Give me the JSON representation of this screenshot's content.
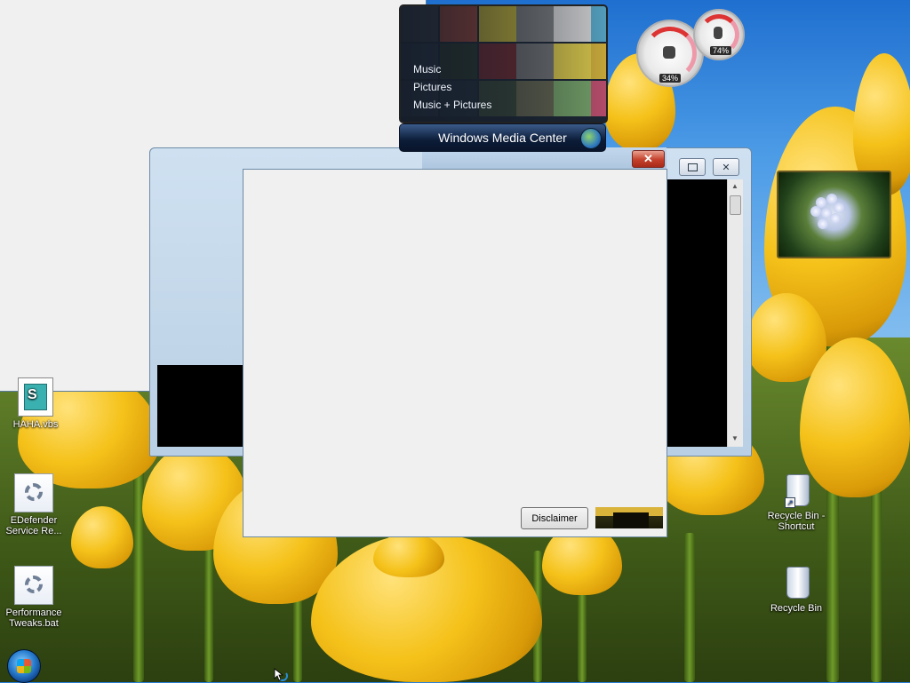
{
  "media_center": {
    "menu": [
      "Music",
      "Pictures",
      "Music + Pictures"
    ],
    "title": "Windows Media Center"
  },
  "meters": {
    "cpu_percent": "34%",
    "memory_percent": "74%",
    "cpu_value": 0.34,
    "memory_value": 0.74
  },
  "dialog": {
    "disclaimer_label": "Disclaimer"
  },
  "console": {
    "close_glyph": "✕",
    "restore_glyph": "▫",
    "minimize_glyph": "_"
  },
  "desktop_icons": {
    "haha": "HAHA.vbs",
    "edefender": "EDefender Service Re...",
    "performance": "Performance Tweaks.bat",
    "recycle_shortcut": "Recycle Bin - Shortcut",
    "recycle": "Recycle Bin"
  },
  "icons": {
    "start": "windows-start-orb",
    "busy": "busy-cursor-icon"
  },
  "colors": {
    "close_red": "#c4412b",
    "window_bg": "#f0f0f0",
    "console_bg": "#000000"
  }
}
